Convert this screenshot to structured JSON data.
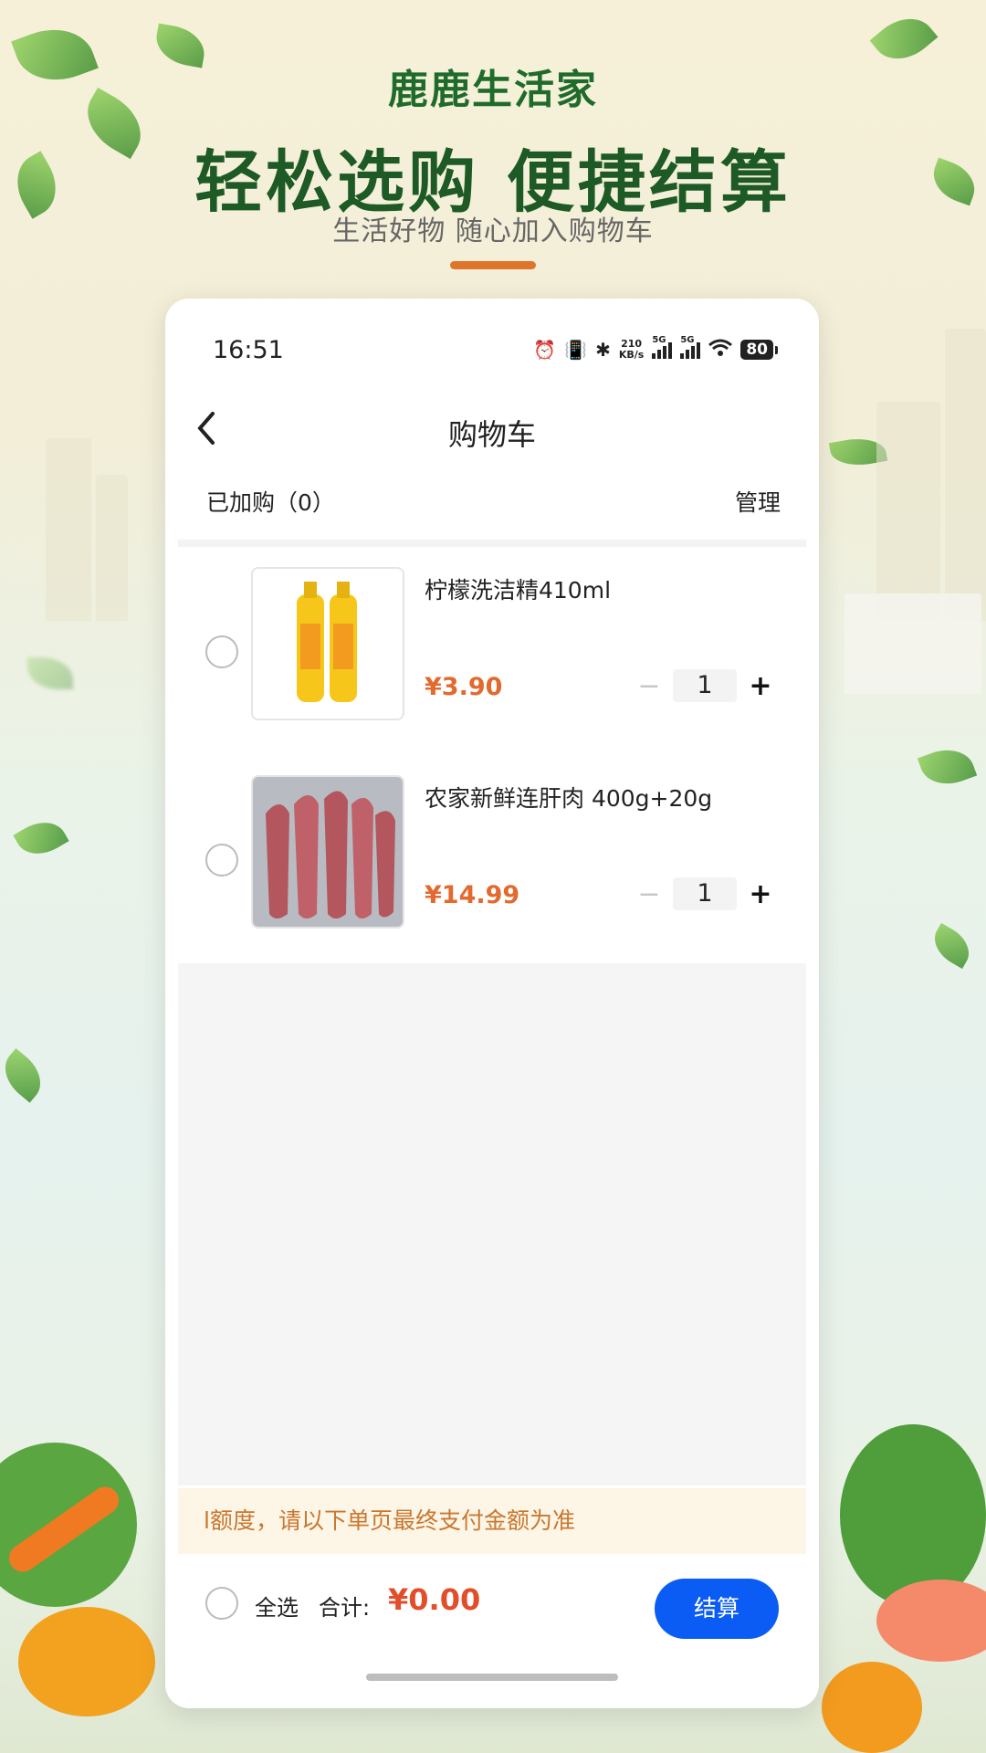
{
  "promo": {
    "brand": "鹿鹿生活家",
    "headline": "轻松选购 便捷结算",
    "subheadline": "生活好物 随心加入购物车"
  },
  "status_bar": {
    "time": "16:51",
    "net_speed_value": "210",
    "net_speed_unit": "KB/s",
    "signal_1_label": "5G",
    "signal_2_label": "5G",
    "battery": "80"
  },
  "nav": {
    "back_icon": "chevron-left-icon",
    "title": "购物车"
  },
  "cart_header": {
    "added_label": "已加购（0）",
    "manage_label": "管理"
  },
  "items": [
    {
      "name": "柠檬洗洁精410ml",
      "price": "¥3.90",
      "quantity": "1",
      "minus": "−",
      "plus": "+"
    },
    {
      "name": "农家新鲜连肝肉 400g+20g",
      "price": "¥14.99",
      "quantity": "1",
      "minus": "−",
      "plus": "+"
    }
  ],
  "notice": "l额度，请以下单页最终支付金额为准",
  "footer": {
    "select_all": "全选",
    "total_label": "合计:",
    "total_value": "¥0.00",
    "checkout": "结算"
  },
  "colors": {
    "brand_green": "#1d5a26",
    "accent_orange": "#e0742c",
    "price_color": "#e26a2e",
    "checkout_blue": "#0b5cf5"
  }
}
